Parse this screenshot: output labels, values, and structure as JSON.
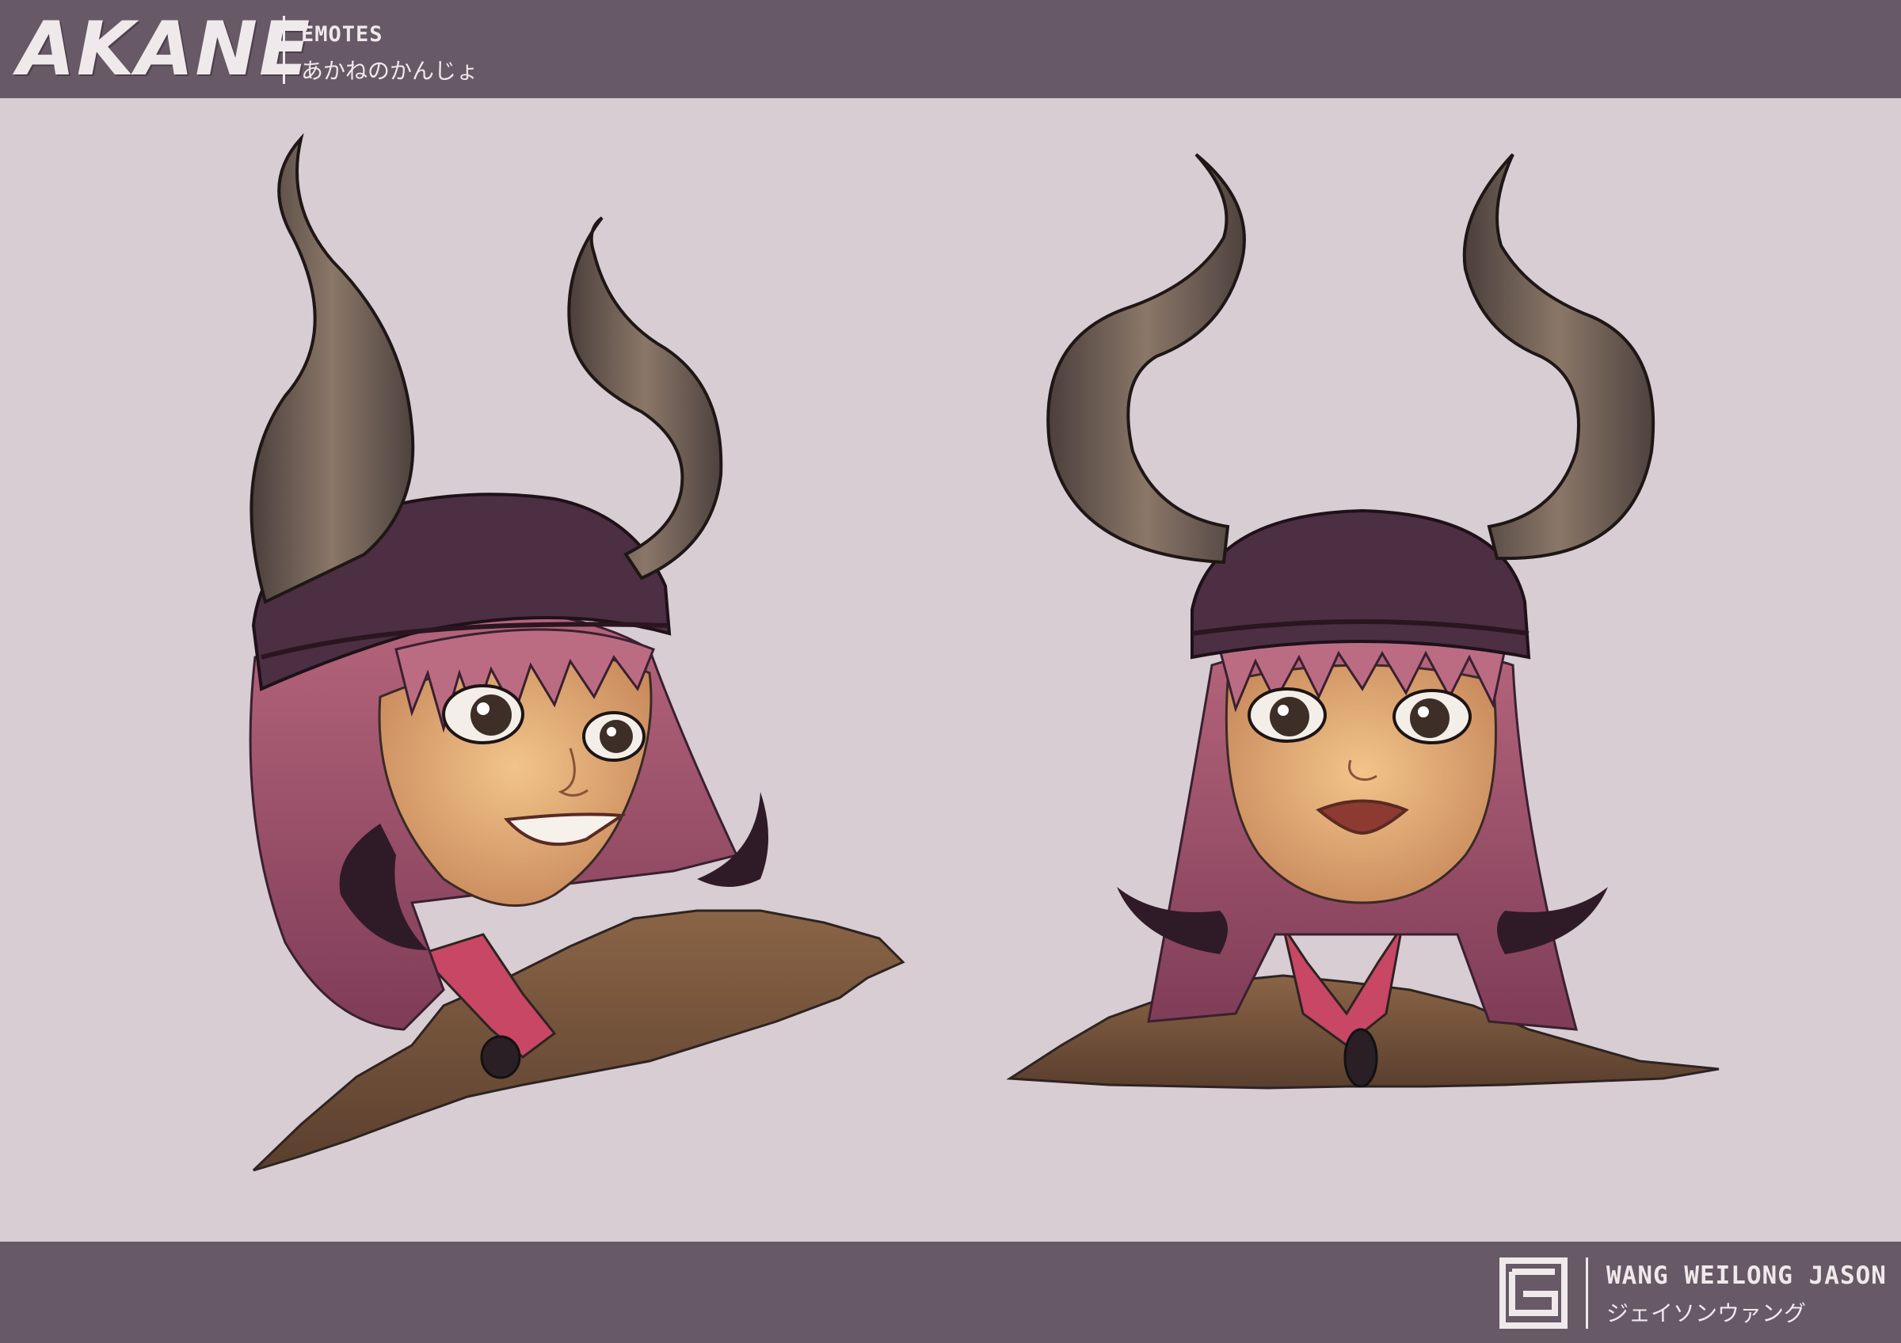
{
  "header": {
    "logo_text": "AKANE",
    "section_title": "EMOTES",
    "section_subtitle": "あかねのかんじょ"
  },
  "footer": {
    "artist_name": "WANG WEILONG JASON",
    "artist_name_kana": "ジェイソンウァング"
  },
  "colors": {
    "bar": "#675965",
    "background": "#d7cdd3",
    "text": "#efe9ec"
  },
  "icons": [
    "artist-logo-icon"
  ]
}
